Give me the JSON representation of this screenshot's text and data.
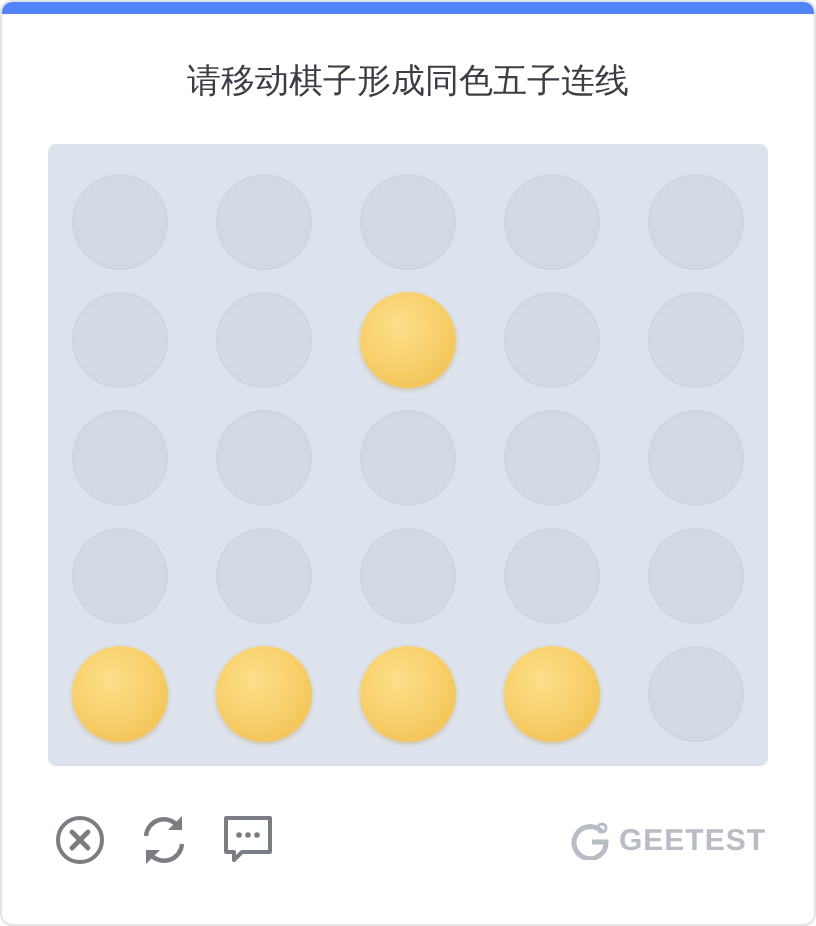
{
  "title": "请移动棋子形成同色五子连线",
  "board": [
    [
      {
        "occupied": false
      },
      {
        "occupied": false
      },
      {
        "occupied": false
      },
      {
        "occupied": false
      },
      {
        "occupied": false
      }
    ],
    [
      {
        "occupied": false
      },
      {
        "occupied": false
      },
      {
        "occupied": true
      },
      {
        "occupied": false
      },
      {
        "occupied": false
      }
    ],
    [
      {
        "occupied": false
      },
      {
        "occupied": false
      },
      {
        "occupied": false
      },
      {
        "occupied": false
      },
      {
        "occupied": false
      }
    ],
    [
      {
        "occupied": false
      },
      {
        "occupied": false
      },
      {
        "occupied": false
      },
      {
        "occupied": false
      },
      {
        "occupied": false
      }
    ],
    [
      {
        "occupied": true
      },
      {
        "occupied": true
      },
      {
        "occupied": true
      },
      {
        "occupied": true
      },
      {
        "occupied": false
      }
    ]
  ],
  "brand": "GEETEST"
}
